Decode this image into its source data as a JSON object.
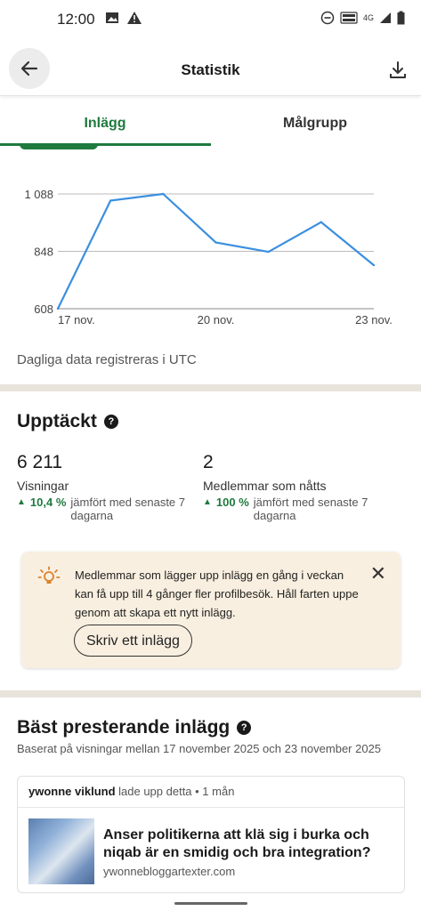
{
  "status_bar": {
    "time": "12:00",
    "network": "4G"
  },
  "app_bar": {
    "title": "Statistik"
  },
  "tabs": [
    {
      "label": "Inlägg"
    },
    {
      "label": "Målgrupp"
    }
  ],
  "chart_data": {
    "type": "line",
    "x": [
      "17 nov.",
      "18 nov.",
      "19 nov.",
      "20 nov.",
      "21 nov.",
      "22 nov.",
      "23 nov."
    ],
    "series": [
      {
        "values": [
          608,
          1060,
          1088,
          885,
          846,
          970,
          790
        ]
      }
    ],
    "xticks": [
      "17 nov.",
      "20 nov.",
      "23 nov."
    ],
    "yticks": [
      "608",
      "848",
      "1 088"
    ],
    "ylim": [
      608,
      1088
    ],
    "grid": true,
    "color": "#3b8fe0"
  },
  "chart_note": "Dagliga data registreras i UTC",
  "discovery": {
    "title": "Upptäckt",
    "help_icon": "?",
    "metrics": [
      {
        "value": "6 211",
        "label": "Visningar",
        "pct": "10,4 %",
        "compare": "jämfört med senaste 7 dagarna"
      },
      {
        "value": "2",
        "label": "Medlemmar som nåtts",
        "pct": "100 %",
        "compare": "jämfört med senaste 7 dagarna"
      }
    ]
  },
  "tip": {
    "text": "Medlemmar som lägger upp inlägg en gång i veckan kan få upp till 4 gånger fler profilbesök. Håll farten uppe genom att skapa ett nytt inlägg.",
    "button": "Skriv ett inlägg",
    "close": "✕"
  },
  "top_posts": {
    "title": "Bäst presterande inlägg",
    "help_icon": "?",
    "subtitle": "Baserat på visningar mellan 17 november 2025 och 23 november 2025",
    "post": {
      "author": "ywonne viklund",
      "meta": " lade upp detta • 1 mån",
      "title": "Anser politikerna att klä sig i burka och niqab är en smidig och bra integration?",
      "domain": "ywonnebloggartexter.com"
    }
  }
}
